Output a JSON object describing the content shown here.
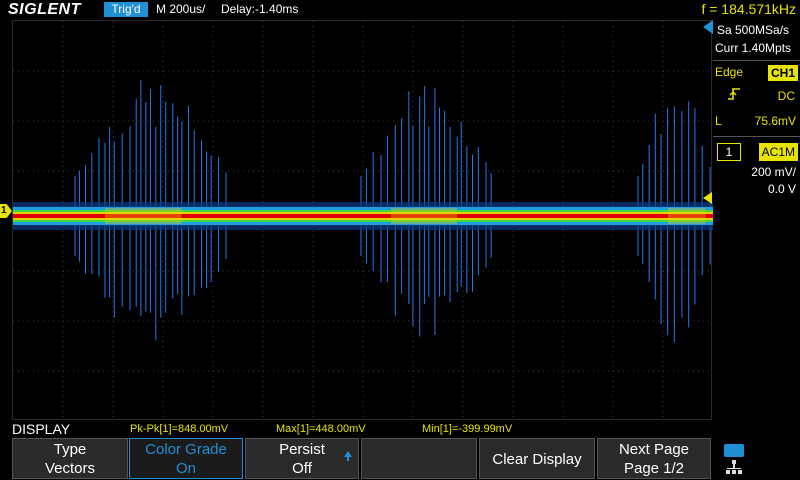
{
  "topbar": {
    "logo": "SIGLENT",
    "trig_status": "Trig'd",
    "timebase": "M 200us/",
    "delay": "Delay:-1.40ms",
    "frequency": "f = 184.571kHz"
  },
  "panel": {
    "sample_rate": "Sa 500MSa/s",
    "memory": "Curr 1.40Mpts",
    "trigger_type": "Edge",
    "trigger_source": "CH1",
    "slope_icon": "rising-edge-icon",
    "coupling": "DC",
    "level_label": "L",
    "level_value": "75.6mV",
    "channel_number": "1",
    "channel_coupling": "AC1M",
    "volts_per_div": "200 mV/",
    "offset": "0.0 V"
  },
  "channel_marker": "1",
  "menu_title": "DISPLAY",
  "measurements": [
    "Pk-Pk[1]=848.00mV",
    "Max[1]=448.00mV",
    "Min[1]=-399.99mV"
  ],
  "softkeys": [
    {
      "line1": "Type",
      "line2": "Vectors",
      "active": false
    },
    {
      "line1": "Color Grade",
      "line2": "On",
      "active": true
    },
    {
      "line1": "Persist",
      "line2": "Off",
      "active": false
    },
    {
      "line1": "Clear Display",
      "active": false
    },
    {
      "line1": "Next Page",
      "line2": "Page 1/2",
      "active": false
    }
  ],
  "colors": {
    "accent_blue": "#1f8fd6",
    "channel_yellow": "#e8e400",
    "trace_core": "#e00000"
  },
  "icons": {
    "usb": "usb-icon",
    "network": "network-icon"
  }
}
